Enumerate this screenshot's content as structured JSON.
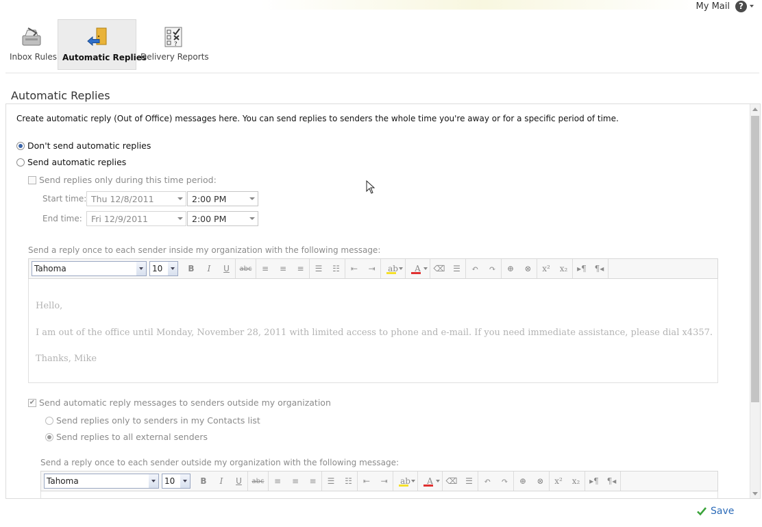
{
  "header": {
    "my_mail": "My Mail",
    "help": "?"
  },
  "tabs": [
    {
      "label": "Inbox Rules",
      "icon": "inbox-rules-icon"
    },
    {
      "label": "Automatic Replies",
      "icon": "automatic-replies-icon",
      "active": true
    },
    {
      "label": "Delivery Reports",
      "icon": "delivery-reports-icon"
    }
  ],
  "page_title": "Automatic Replies",
  "intro": "Create automatic reply (Out of Office) messages here. You can send replies to senders the whole time you're away or for a specific period of time.",
  "options": {
    "dont_send": "Don't send automatic replies",
    "send": "Send automatic replies",
    "selected": "dont_send"
  },
  "time_period": {
    "label": "Send replies only during this time period:",
    "checked": false,
    "start_label": "Start time:",
    "start_date": "Thu 12/8/2011",
    "start_time": "2:00 PM",
    "end_label": "End time:",
    "end_date": "Fri 12/9/2011",
    "end_time": "2:00 PM"
  },
  "inside": {
    "label": "Send a reply once to each sender inside my organization with the following message:",
    "font": "Tahoma",
    "size": "10",
    "body": [
      "Hello,",
      "I am out of the office until Monday, November 28, 2011 with limited access to phone and e-mail. If you need immediate assistance, please dial x4357.",
      "Thanks, Mike"
    ]
  },
  "outside": {
    "check_label": "Send automatic reply messages to senders outside my organization",
    "checked": true,
    "contacts_only": "Send replies only to senders in my Contacts list",
    "all_external": "Send replies to all external senders",
    "selected": "all_external",
    "label": "Send a reply once to each sender outside my organization with the following message:",
    "font": "Tahoma",
    "size": "10"
  },
  "toolbar_glyphs": {
    "bold": "B",
    "italic": "I",
    "underline": "U",
    "strike": "abc",
    "superscript": "x²",
    "subscript": "x₂",
    "font_color": "A",
    "highlight": "ab"
  },
  "colors": {
    "accent": "#2a6ab8",
    "save_check": "#3aa33a",
    "highlight_bar": "#f5e02a",
    "font_color_bar": "#e03030"
  },
  "save_label": "Save"
}
